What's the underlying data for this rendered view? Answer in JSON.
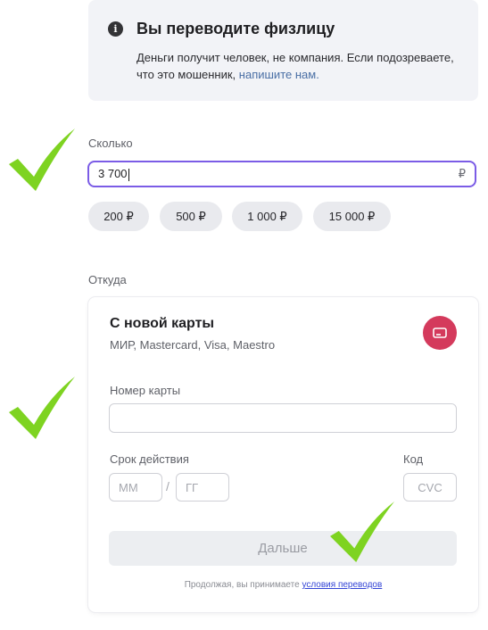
{
  "banner": {
    "icon": "info-icon",
    "title": "Вы переводите физлицу",
    "text": "Деньги получит человек, не компания. Если подозреваете, что это мошенник,",
    "link": "напишите нам."
  },
  "amount": {
    "label": "Сколько",
    "value": "3 700",
    "currency": "₽",
    "chips": [
      "200 ₽",
      "500 ₽",
      "1 000 ₽",
      "15 000 ₽"
    ]
  },
  "source": {
    "label": "Откуда",
    "title": "С новой карты",
    "subtitle": "МИР, Mastercard, Visa, Maestro",
    "icon": "card-icon",
    "accent": "#d43a5c",
    "card_number_label": "Номер карты",
    "card_number_value": "",
    "expiry_label": "Срок действия",
    "month_placeholder": "ММ",
    "separator": "/",
    "year_placeholder": "ГГ",
    "code_label": "Код",
    "code_placeholder": "CVC",
    "next_button": "Дальше",
    "terms_text": "Продолжая, вы принимаете",
    "terms_link": "условия переводов"
  },
  "annotations": {
    "checkmark_color": "#7ed321",
    "icon": "checkmark-icon"
  }
}
